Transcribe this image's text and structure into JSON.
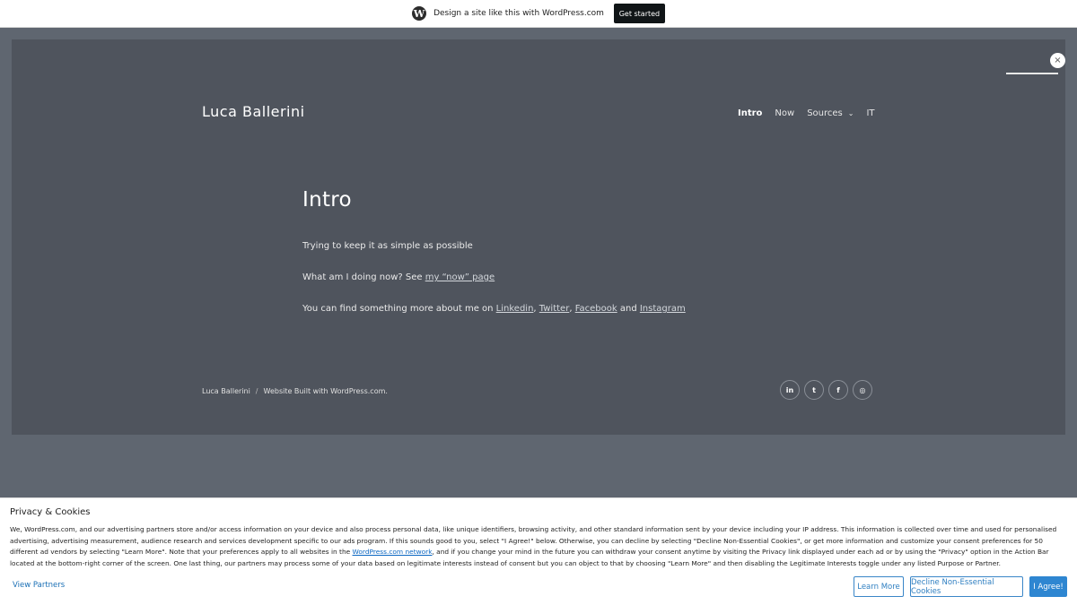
{
  "wp_bar": {
    "icon": "wordpress-logo-icon",
    "text": "Design a site like this with WordPress.com",
    "button": "Get started"
  },
  "header": {
    "site_title": "Luca Ballerini",
    "nav": [
      {
        "label": "Intro",
        "active": true
      },
      {
        "label": "Now",
        "active": false
      },
      {
        "label": "Sources",
        "active": false,
        "dropdown": true
      },
      {
        "label": "IT",
        "active": false
      }
    ]
  },
  "main": {
    "title": "Intro",
    "p1": "Trying to keep it as simple as possible",
    "p2_prefix": "What am I doing now? See ",
    "p2_link": "my “now” page",
    "p3_prefix": "You can find something more about me on ",
    "p3_links": [
      "Linkedin",
      "Twitter",
      "Facebook",
      "Instagram"
    ],
    "p3_comma": ",",
    "p3_and": " and "
  },
  "footer": {
    "name": "Luca Ballerini",
    "separator": "/",
    "built": "Website Built with WordPress.com.",
    "socials": [
      {
        "icon": "linkedin-icon",
        "glyph": "in"
      },
      {
        "icon": "twitter-icon",
        "glyph": "t"
      },
      {
        "icon": "facebook-icon",
        "glyph": "f"
      },
      {
        "icon": "instagram-icon",
        "glyph": "◎"
      }
    ]
  },
  "cookie": {
    "title": "Privacy & Cookies",
    "body_1": "We, WordPress.com, and our advertising partners store and/or access information on your device and also process personal data, like unique identifiers, browsing activity, and other standard information sent by your device including your IP address. This information is collected over time and used for personalised advertising, advertising measurement, audience research and services development specific to our ads program. If this sounds good to you, select \"I Agree!\" below. Otherwise, you can decline by selecting \"Decline Non-Essential Cookies\", or get more information and customize your consent preferences for 50 different ad vendors by selecting \"Learn More\". Note that your preferences apply to all websites in the ",
    "body_link": "WordPress.com network",
    "body_2": ", and if you change your mind in the future you can withdraw your consent anytime by visiting the Privacy link displayed under each ad or by using the \"Privacy\" option in the Action Bar located at the bottom-right corner of the screen. One last thing, our partners may process some of your data based on legitimate interests instead of consent but you can object to that by choosing \"Learn More\" and then disabling the Legitimate Interests toggle under any listed Purpose or Partner.",
    "view_partners": "View Partners",
    "learn_more": "Learn More",
    "decline": "Decline Non-Essential Cookies",
    "agree": "I Agree!"
  },
  "close_glyph": "×"
}
